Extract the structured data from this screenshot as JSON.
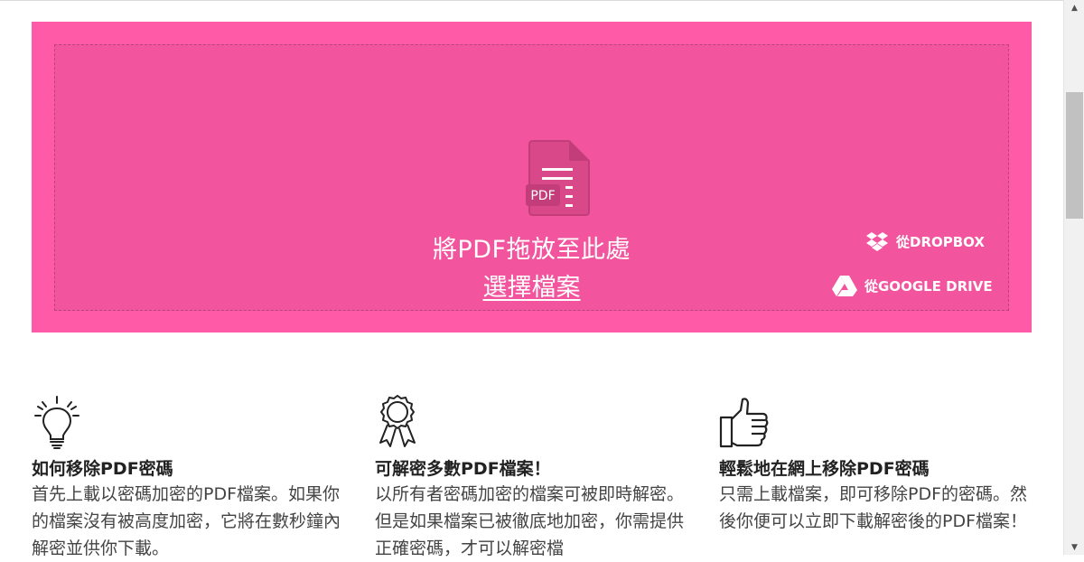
{
  "dropzone": {
    "drop_text": "將PDF拖放至此處",
    "choose_file": "選擇檔案",
    "pdf_badge": "PDF",
    "dropbox_label": "從DROPBOX",
    "gdrive_label": "從GOOGLE DRIVE"
  },
  "features": [
    {
      "icon": "lightbulb-icon",
      "title": "如何移除PDF密碼",
      "text": "首先上載以密碼加密的PDF檔案。如果你的檔案沒有被高度加密，它將在數秒鐘內解密並供你下載。"
    },
    {
      "icon": "award-icon",
      "title": "可解密多數PDF檔案！",
      "text": "以所有者密碼加密的檔案可被即時解密。但是如果檔案已被徹底地加密，你需提供正確密碼，才可以解密檔"
    },
    {
      "icon": "thumbs-up-icon",
      "title": "輕鬆地在網上移除PDF密碼",
      "text": "只需上載檔案，即可移除PDF的密碼。然後你便可以立即下載解密後的PDF檔案！"
    }
  ],
  "colors": {
    "dropzone_bg": "#ff5aa7",
    "dropzone_inner": "#f2559e"
  }
}
